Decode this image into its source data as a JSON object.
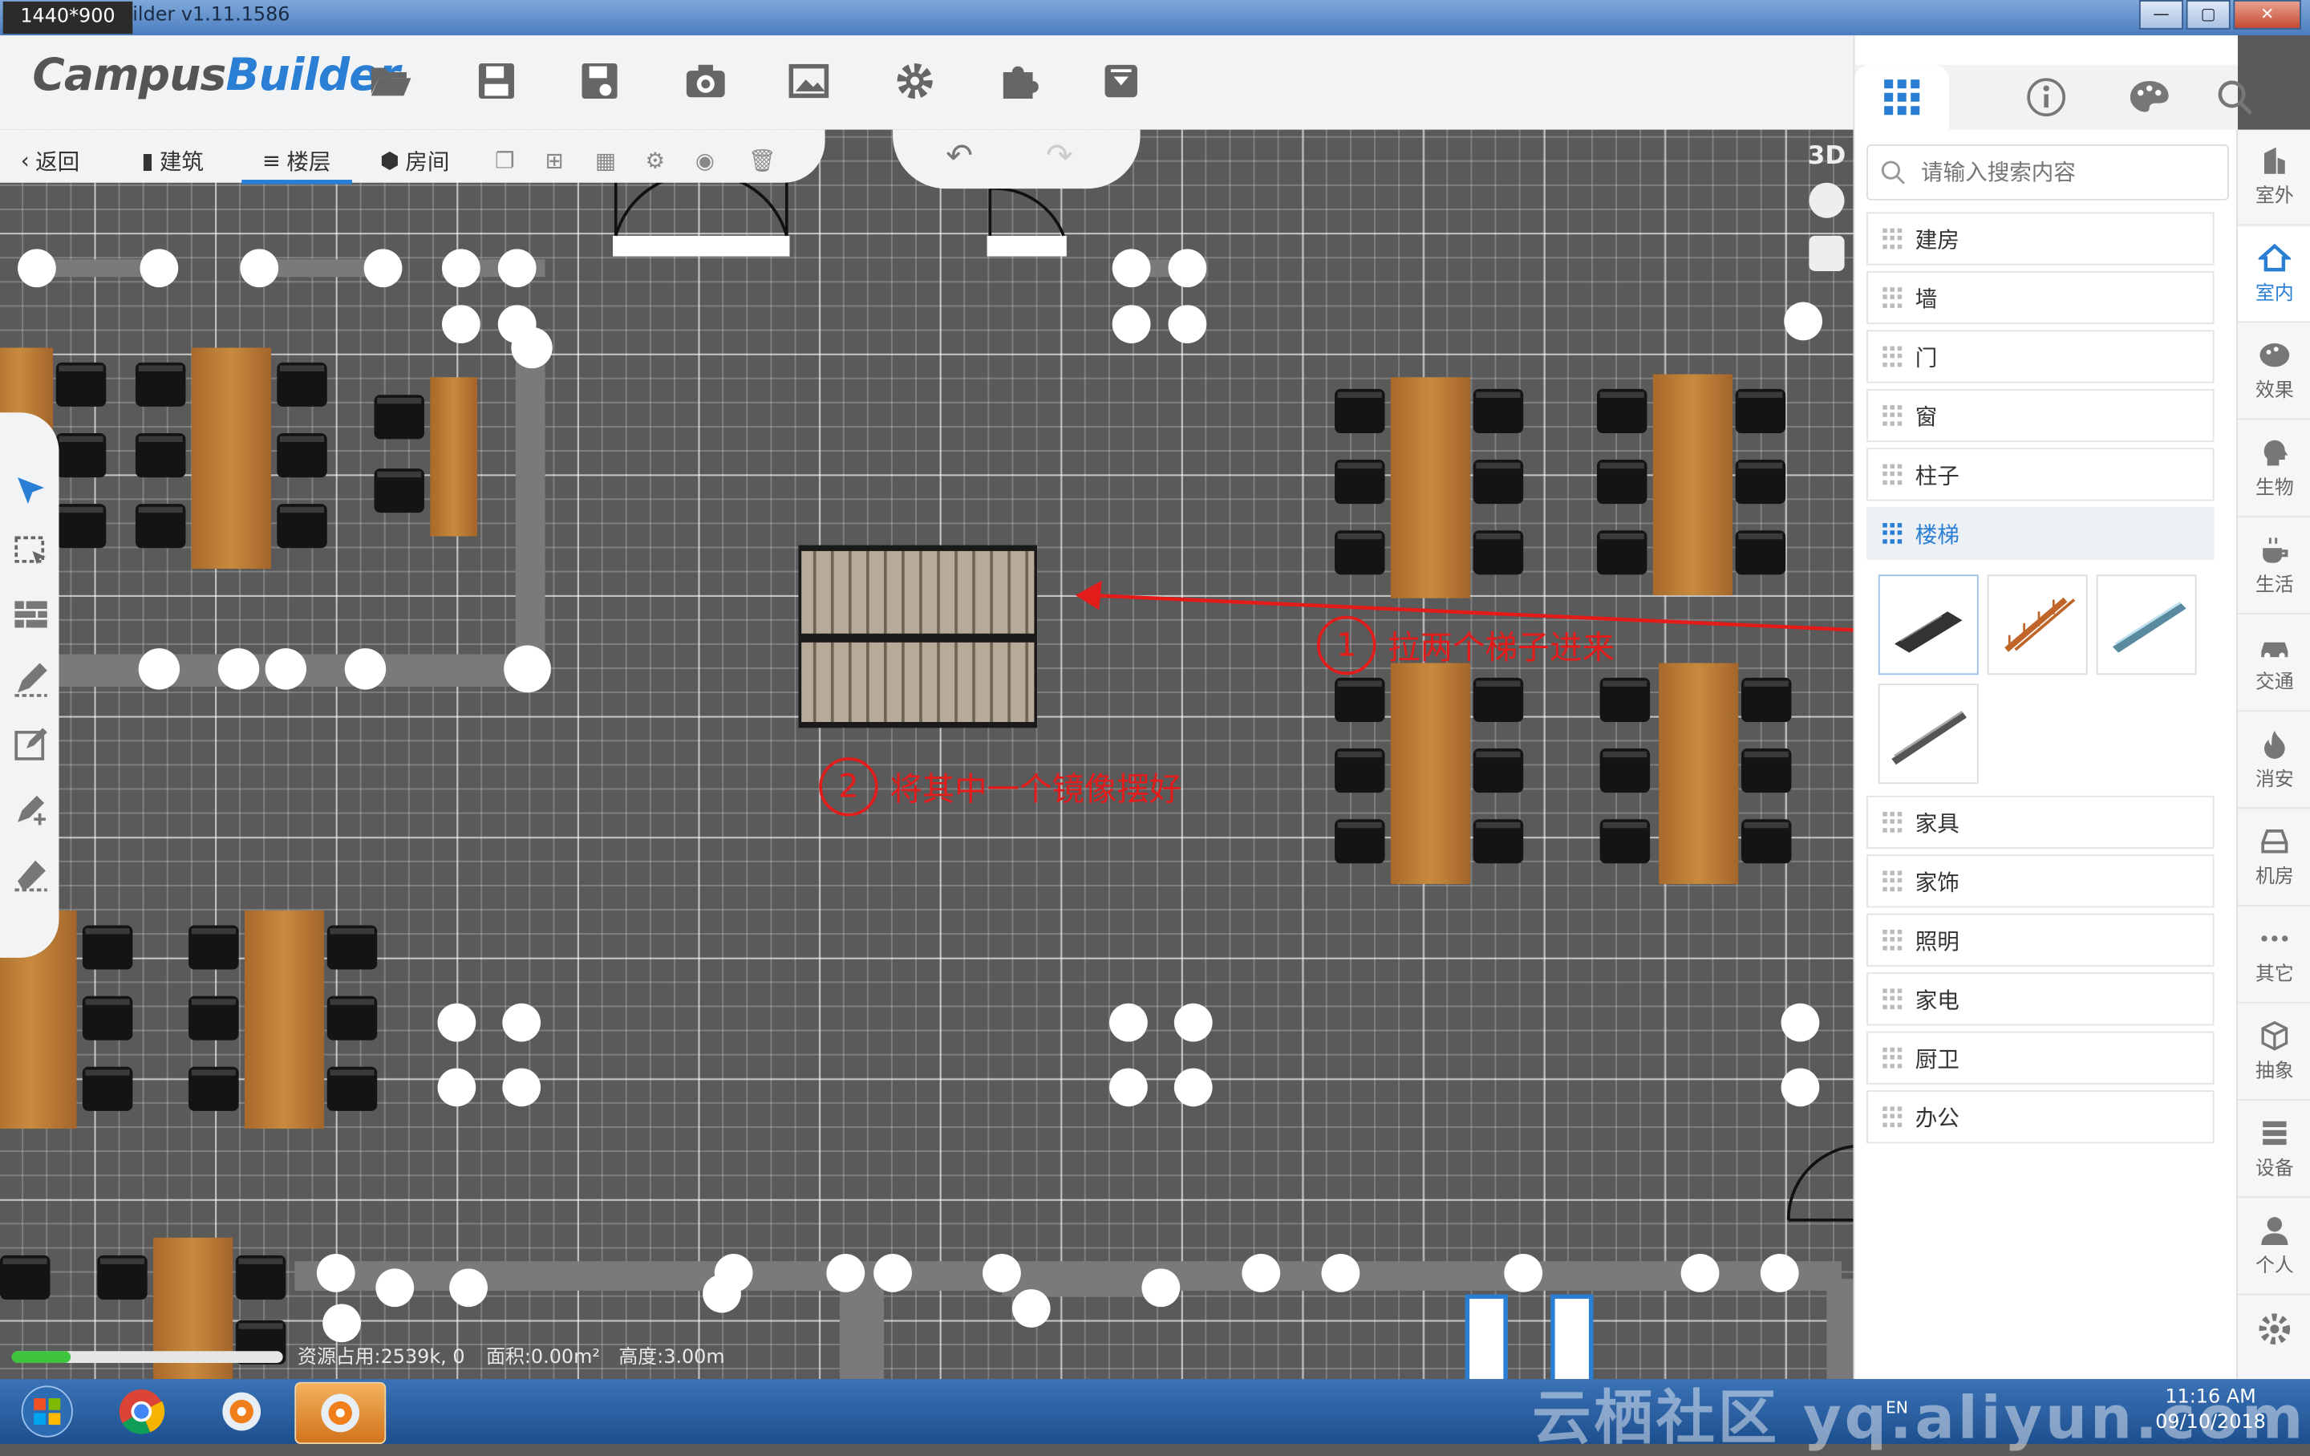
{
  "window": {
    "resolution_badge": "1440*900",
    "title": "ilder v1.11.1586",
    "buttons": [
      "—",
      "▢",
      "✕"
    ]
  },
  "logo": {
    "part1": "Campus",
    "part2": "Builder"
  },
  "toolbar": {
    "icons": [
      "folder-open-icon",
      "save-icon",
      "save-as-icon",
      "camera-icon",
      "image-icon",
      "settings-icon",
      "plugin-icon",
      "download-icon"
    ]
  },
  "subbar": {
    "back": "返回",
    "building": "建筑",
    "floor": "楼层",
    "room": "房间"
  },
  "view": {
    "mode": "3D"
  },
  "panel": {
    "search_placeholder": "请输入搜索内容",
    "categories_top": [
      "建房",
      "墙",
      "门",
      "窗",
      "柱子"
    ],
    "active_category": "楼梯",
    "categories_bottom": [
      "家具",
      "家饰",
      "照明",
      "家电",
      "厨卫",
      "办公"
    ]
  },
  "rail": {
    "items": [
      "室外",
      "室内",
      "效果",
      "生物",
      "生活",
      "交通",
      "消安",
      "机房",
      "其它",
      "抽象",
      "设备",
      "个人"
    ]
  },
  "annotations": {
    "step1_num": "1",
    "step1": "拉两个梯子进来",
    "step2_num": "2",
    "step2": "将其中一个镜像摆好"
  },
  "status": {
    "progress": 0.22,
    "memory_label": "资源占用:2539k, 0",
    "area_label": "面积:0.00m²",
    "height_label": "高度:3.00m"
  },
  "taskbar": {
    "lang": "EN",
    "time": "11:16 AM",
    "date": "09/10/2018"
  },
  "watermark": "云栖社区 yq.aliyun.com",
  "colors": {
    "accent": "#2a7fd4",
    "annotation": "#e21b1b",
    "grid": "#5a5a5a",
    "wood": "#b8792f"
  }
}
